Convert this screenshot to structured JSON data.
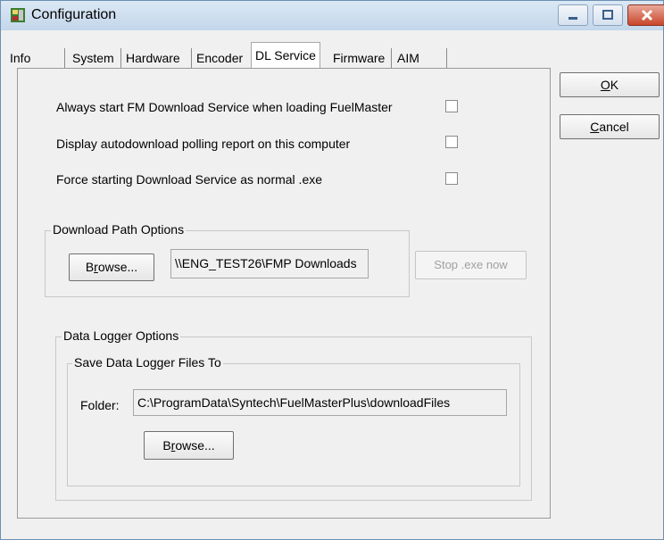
{
  "window": {
    "title": "Configuration"
  },
  "tabs": [
    {
      "label": "Info",
      "active": false
    },
    {
      "label": "System",
      "active": false
    },
    {
      "label": "Hardware",
      "active": false
    },
    {
      "label": "Encoder",
      "active": false
    },
    {
      "label": "DL Service",
      "active": true
    },
    {
      "label": "Firmware",
      "active": false
    },
    {
      "label": "AIM",
      "active": false
    }
  ],
  "dialog_buttons": {
    "ok_label": "OK",
    "ok_mnemonic": "O",
    "ok_rest": "K",
    "cancel_label": "Cancel",
    "cancel_mnemonic": "C",
    "cancel_rest": "ancel"
  },
  "options": {
    "always_start_label": "Always start FM Download Service  when loading FuelMaster",
    "always_start_checked": false,
    "display_polling_label": "Display autodownload polling report on this computer",
    "display_polling_checked": false,
    "force_exe_label": "Force starting Download Service as normal .exe",
    "force_exe_checked": false
  },
  "download_path": {
    "group_label": "Download Path Options",
    "browse_pre": "B",
    "browse_mnemonic": "r",
    "browse_post": "owse...",
    "path_value": "\\\\ENG_TEST26\\FMP Downloads",
    "stop_label": "Stop .exe now",
    "stop_enabled": false
  },
  "data_logger": {
    "group_label": "Data Logger Options",
    "save_group_label": "Save Data Logger Files To",
    "folder_label": "Folder:",
    "folder_value": "C:\\ProgramData\\Syntech\\FuelMasterPlus\\downloadFiles",
    "browse_pre": "B",
    "browse_mnemonic": "r",
    "browse_post": "owse..."
  }
}
